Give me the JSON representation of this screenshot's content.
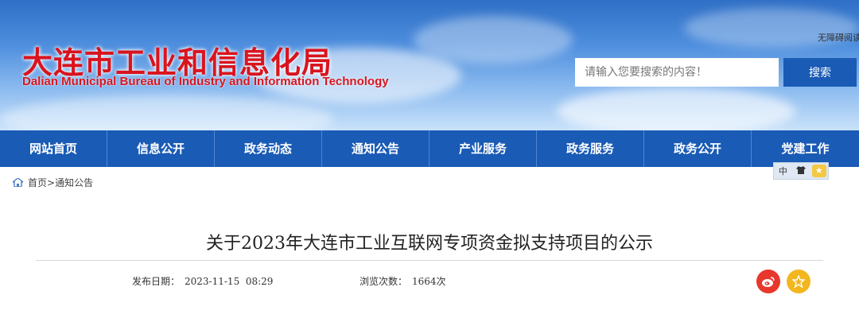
{
  "header": {
    "site_title": "大连市工业和信息化局",
    "site_subtitle": "Dalian Municipal Bureau of Industry and Information Technology",
    "accessible_link": "无障碍阅读",
    "search_placeholder": "请输入您要搜索的内容！",
    "search_button": "搜索"
  },
  "nav": {
    "items": [
      {
        "label": "网站首页"
      },
      {
        "label": "信息公开"
      },
      {
        "label": "政务动态"
      },
      {
        "label": "通知公告"
      },
      {
        "label": "产业服务"
      },
      {
        "label": "政务服务"
      },
      {
        "label": "政务公开"
      },
      {
        "label": "党建工作"
      }
    ]
  },
  "toolbar": {
    "lang": "中",
    "icon_names": [
      "language-icon",
      "shirt-icon",
      "favorite-icon"
    ]
  },
  "breadcrumb": {
    "home": "首页",
    "separator": ">",
    "current": "通知公告"
  },
  "article": {
    "title": "关于2023年大连市工业互联网专项资金拟支持项目的公示",
    "date_label": "发布日期：",
    "date_value": "2023-11-15  08:29",
    "views_label": "浏览次数：",
    "views_value": "1664次"
  },
  "colors": {
    "brand_red": "#d9141e",
    "nav_blue": "#1a5bb5",
    "weibo_red": "#e8372d",
    "favorite_yellow": "#f2b61f"
  }
}
